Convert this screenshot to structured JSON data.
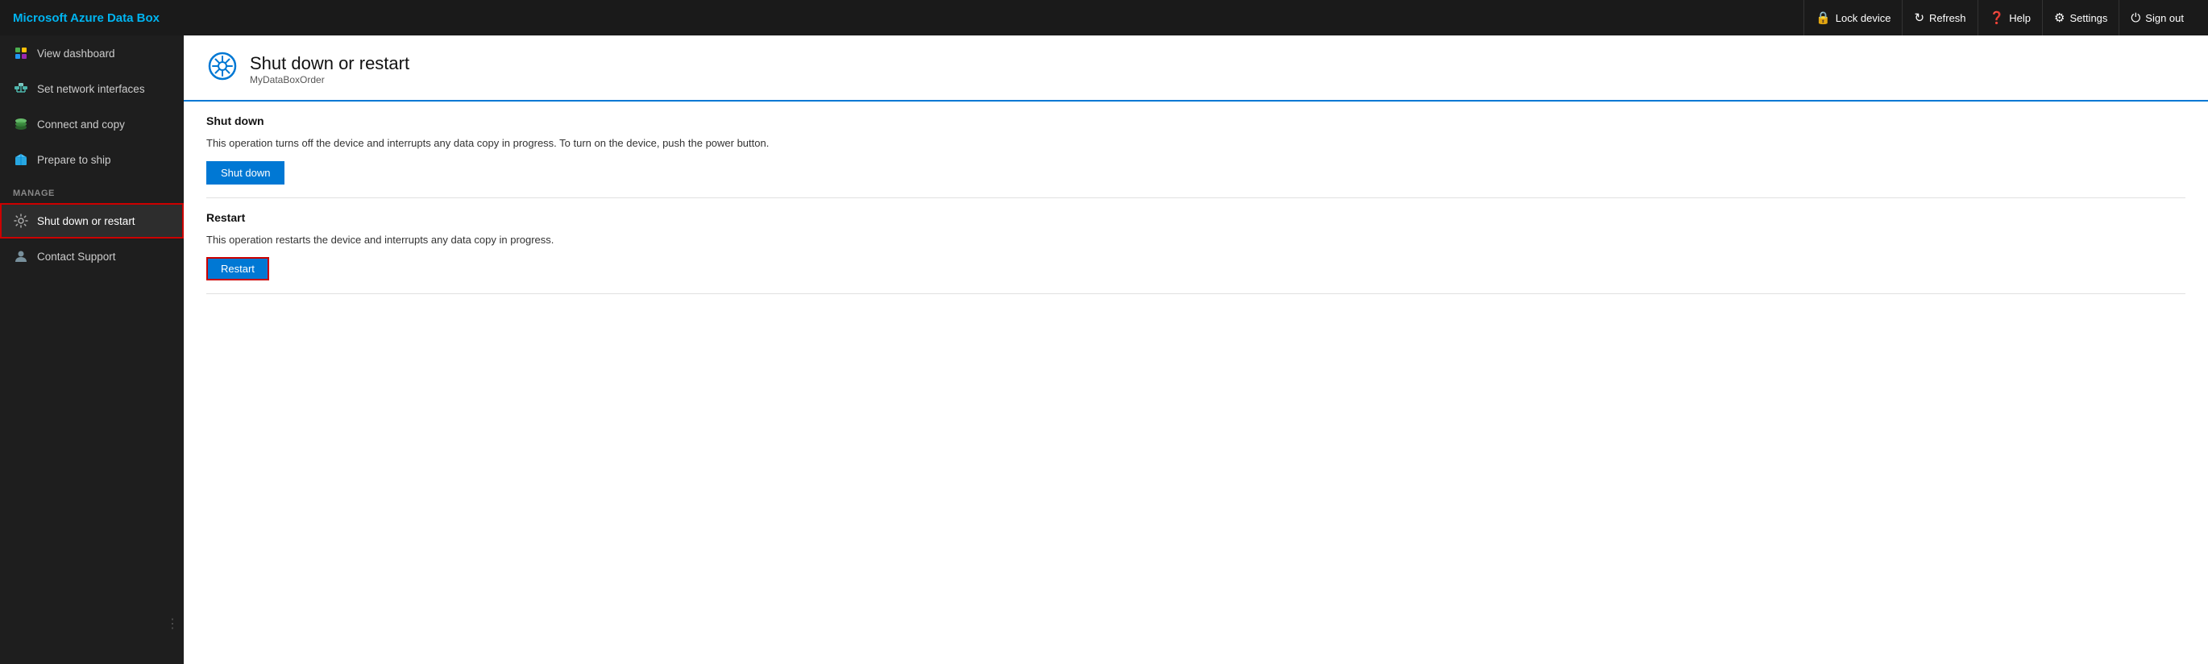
{
  "brand": "Microsoft Azure Data Box",
  "topNav": {
    "actions": [
      {
        "id": "lock-device",
        "icon": "🔒",
        "label": "Lock device"
      },
      {
        "id": "refresh",
        "icon": "↻",
        "label": "Refresh"
      },
      {
        "id": "help",
        "icon": "❓",
        "label": "Help"
      },
      {
        "id": "settings",
        "icon": "⚙",
        "label": "Settings"
      },
      {
        "id": "sign-out",
        "icon": "⏻",
        "label": "Sign out"
      }
    ]
  },
  "sidebar": {
    "navItems": [
      {
        "id": "view-dashboard",
        "label": "View dashboard",
        "icon": "grid"
      },
      {
        "id": "set-network-interfaces",
        "label": "Set network interfaces",
        "icon": "network"
      },
      {
        "id": "connect-and-copy",
        "label": "Connect and copy",
        "icon": "layers"
      },
      {
        "id": "prepare-to-ship",
        "label": "Prepare to ship",
        "icon": "box"
      }
    ],
    "manageLabel": "MANAGE",
    "manageItems": [
      {
        "id": "shut-down-or-restart",
        "label": "Shut down or restart",
        "icon": "gear",
        "active": true
      },
      {
        "id": "contact-support",
        "label": "Contact Support",
        "icon": "person"
      }
    ]
  },
  "page": {
    "title": "Shut down or restart",
    "subtitle": "MyDataBoxOrder",
    "sections": [
      {
        "id": "shutdown",
        "title": "Shut down",
        "description": "This operation turns off the device and interrupts any data copy in progress. To turn on the device, push the power button.",
        "buttonLabel": "Shut down",
        "buttonId": "shutdown-button"
      },
      {
        "id": "restart",
        "title": "Restart",
        "description": "This operation restarts the device and interrupts any data copy in progress.",
        "buttonLabel": "Restart",
        "buttonId": "restart-button"
      }
    ]
  }
}
